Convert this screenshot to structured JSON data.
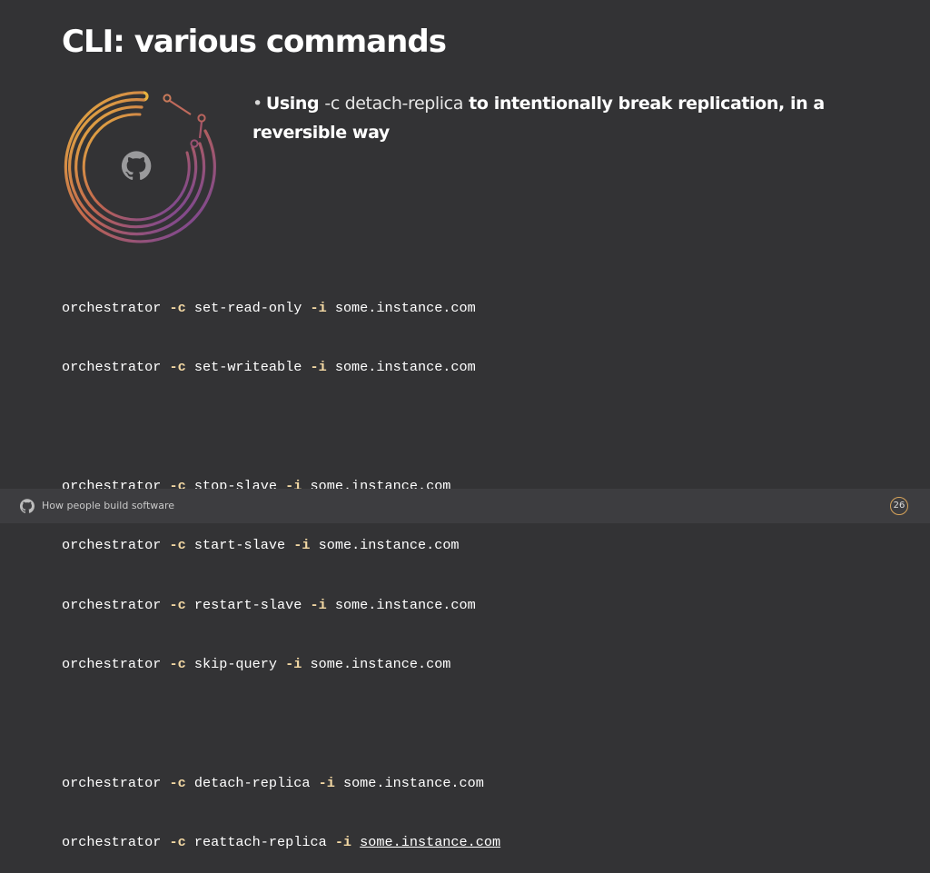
{
  "slide": {
    "title": "CLI: various commands",
    "bullet": {
      "prefix": "Using",
      "code": "-c detach-replica",
      "suffix": "to intentionally break replication, in a reversible way"
    },
    "commands": [
      {
        "cmd": "orchestrator",
        "flag1": "-c",
        "action": "set-read-only",
        "flag2": "-i",
        "host": "some.instance.com"
      },
      {
        "cmd": "orchestrator",
        "flag1": "-c",
        "action": "set-writeable",
        "flag2": "-i",
        "host": "some.instance.com"
      },
      {
        "cmd": "orchestrator",
        "flag1": "-c",
        "action": "stop-slave",
        "flag2": "-i",
        "host": "some.instance.com"
      },
      {
        "cmd": "orchestrator",
        "flag1": "-c",
        "action": "start-slave",
        "flag2": "-i",
        "host": "some.instance.com"
      },
      {
        "cmd": "orchestrator",
        "flag1": "-c",
        "action": "restart-slave",
        "flag2": "-i",
        "host": "some.instance.com"
      },
      {
        "cmd": "orchestrator",
        "flag1": "-c",
        "action": "skip-query",
        "flag2": "-i",
        "host": "some.instance.com"
      },
      {
        "cmd": "orchestrator",
        "flag1": "-c",
        "action": "detach-replica",
        "flag2": "-i",
        "host": "some.instance.com"
      },
      {
        "cmd": "orchestrator",
        "flag1": "-c",
        "action": "reattach-replica",
        "flag2": "-i",
        "host": "some.instance.com"
      }
    ]
  },
  "footer": {
    "tagline": "How people build software",
    "page_number": "26"
  },
  "icons": {
    "logo": "github-octocat-icon",
    "footer_logo": "github-octocat-icon"
  },
  "colors": {
    "background": "#333335",
    "flag_accent": "#f4d9a4",
    "ring_gold": "#e2a33c",
    "ring_purple": "#6b3fa0"
  }
}
